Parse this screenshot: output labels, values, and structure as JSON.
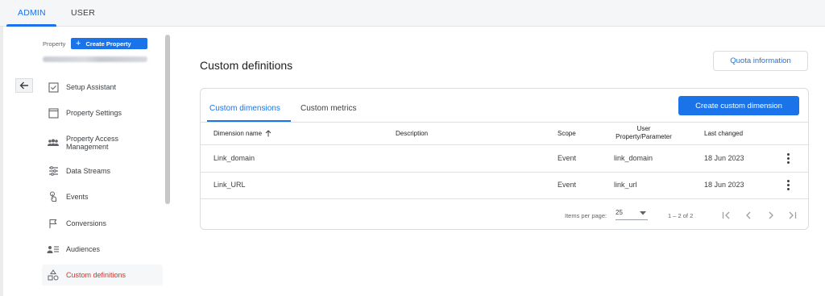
{
  "top_tabs": {
    "admin": "ADMIN",
    "user": "USER"
  },
  "sidebar": {
    "property_label": "Property",
    "create_property": "Create Property",
    "items": [
      {
        "label": "Setup Assistant",
        "icon": "checkbox-icon"
      },
      {
        "label": "Property Settings",
        "icon": "window-icon"
      },
      {
        "label": "Property Access Management",
        "icon": "people-icon"
      },
      {
        "label": "Data Streams",
        "icon": "streams-icon"
      },
      {
        "label": "Events",
        "icon": "touch-icon"
      },
      {
        "label": "Conversions",
        "icon": "flag-icon"
      },
      {
        "label": "Audiences",
        "icon": "audience-icon"
      },
      {
        "label": "Custom definitions",
        "icon": "shapes-icon"
      }
    ]
  },
  "main": {
    "title": "Custom definitions",
    "quota_button": "Quota information",
    "tabs": [
      "Custom dimensions",
      "Custom metrics"
    ],
    "create_button": "Create custom dimension",
    "columns": {
      "name": "Dimension name",
      "description": "Description",
      "scope": "Scope",
      "user_prop_1": "User",
      "user_prop_2": "Property/Parameter",
      "last_changed": "Last changed"
    },
    "rows": [
      {
        "name": "Link_domain",
        "description": "",
        "scope": "Event",
        "param": "link_domain",
        "changed": "18 Jun 2023"
      },
      {
        "name": "Link_URL",
        "description": "",
        "scope": "Event",
        "param": "link_url",
        "changed": "18 Jun 2023"
      }
    ],
    "pager": {
      "items_label": "Items per page:",
      "items_value": "25",
      "range": "1 – 2 of 2"
    }
  },
  "colors": {
    "accent": "#1a73e8",
    "active_nav": "#d93025"
  }
}
